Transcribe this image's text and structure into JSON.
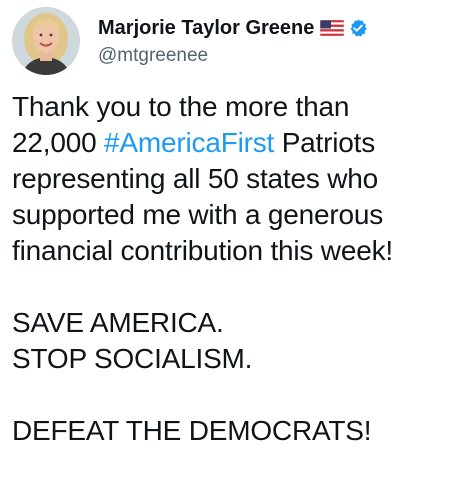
{
  "author": {
    "display_name": "Marjorie Taylor Greene",
    "handle": "@mtgreenee",
    "flag_icon": "us-flag-icon",
    "verified_icon": "verified-badge-icon",
    "verified_color": "#1d9bf0"
  },
  "tweet": {
    "line1": "Thank you to the more than",
    "line2_before": "22,000 ",
    "hashtag": "#AmericaFirst",
    "line2_after": " Patriots",
    "line3": "representing all 50 states who",
    "line4": "supported me with a generous",
    "line5": "financial contribution this week!",
    "line6": "SAVE AMERICA.",
    "line7": "STOP SOCIALISM.",
    "line8": "DEFEAT THE DEMOCRATS!"
  },
  "colors": {
    "text": "#0f1419",
    "muted": "#536471",
    "link": "#1d9bf0"
  }
}
